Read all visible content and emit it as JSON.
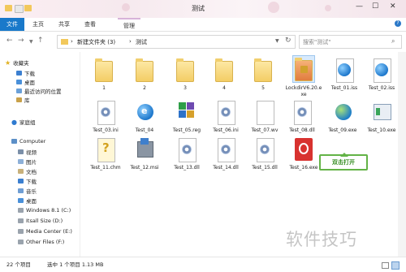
{
  "window": {
    "title": "测试"
  },
  "ribbon": {
    "tabs": [
      "文件",
      "主页",
      "共享",
      "查看",
      "管理"
    ]
  },
  "address": {
    "crumbs": [
      "新建文件夹 (3)",
      "测试"
    ],
    "separator": "›"
  },
  "search": {
    "placeholder": "搜索\"测试\""
  },
  "sidebar": {
    "favorites": {
      "label": "收藏夹",
      "items": [
        "下载",
        "桌面",
        "最近访问的位置",
        "库"
      ]
    },
    "homegroup": "家庭组",
    "computer": {
      "label": "Computer",
      "items": [
        "视频",
        "图片",
        "文档",
        "下载",
        "音乐",
        "桌面",
        "Windows 8.1 (C:)",
        "Itsall Size (D:)",
        "Media Center (E:)",
        "Other Files (F:)"
      ]
    }
  },
  "files": [
    {
      "name": "1",
      "icon": "folder"
    },
    {
      "name": "2",
      "icon": "folder"
    },
    {
      "name": "3",
      "icon": "folder"
    },
    {
      "name": "4",
      "icon": "folder"
    },
    {
      "name": "5",
      "icon": "folder"
    },
    {
      "name": "LockdirV6.20.exe",
      "icon": "lock-folder",
      "selected": true
    },
    {
      "name": "Test_01.iss",
      "icon": "iss"
    },
    {
      "name": "Test_02.iss",
      "icon": "iss"
    },
    {
      "name": "Test_03.ini",
      "icon": "settings"
    },
    {
      "name": "Test_04",
      "icon": "ie"
    },
    {
      "name": "Test_05.reg",
      "icon": "registry"
    },
    {
      "name": "Test_06.ini",
      "icon": "settings"
    },
    {
      "name": "Test_07.wv",
      "icon": "document"
    },
    {
      "name": "Test_08.dll",
      "icon": "dll"
    },
    {
      "name": "Test_09.exe",
      "icon": "app-globe"
    },
    {
      "name": "Test_10.exe",
      "icon": "app"
    },
    {
      "name": "Test_11.chm",
      "icon": "help"
    },
    {
      "name": "Test_12.msi",
      "icon": "installer"
    },
    {
      "name": "Test_13.dll",
      "icon": "dll"
    },
    {
      "name": "Test_14.dll",
      "icon": "dll"
    },
    {
      "name": "Test_15.dll",
      "icon": "dll"
    },
    {
      "name": "Test_16.exe",
      "icon": "red-app"
    }
  ],
  "callout": "双击打开",
  "status": {
    "count": "22 个项目",
    "selection": "选中 1 个项目 1.13 MB"
  },
  "watermark": "软件技巧",
  "colors": {
    "accent": "#1979ca",
    "folder": "#f3cc63",
    "callout": "#63b347"
  }
}
